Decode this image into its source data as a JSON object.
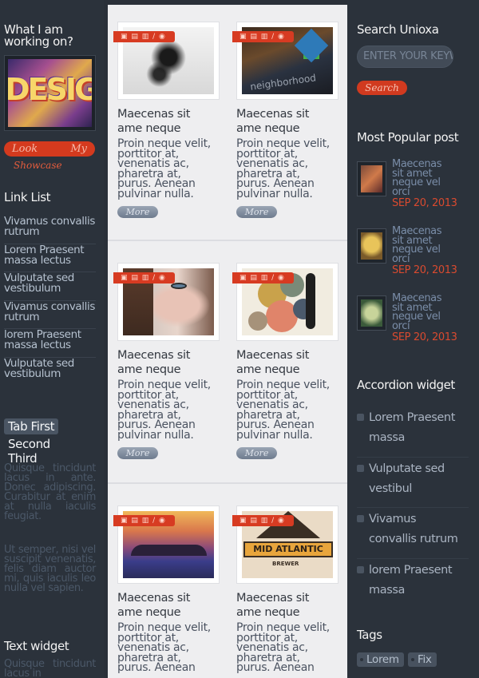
{
  "left": {
    "working_title": "What I am working on?",
    "showcase_image_text": "DESIGN",
    "showcase_btn_left": "Look",
    "showcase_btn_right": "My",
    "showcase_btn_line2": "Showcase",
    "linklist_title": "Link List",
    "links": [
      "Vivamus convallis rutrum",
      "Lorem Praesent massa lectus",
      "Vulputate sed vestibulum",
      "Vivamus convallis rutrum",
      "lorem Praesent massa lectus",
      "Vulputate sed vestibulum"
    ],
    "tabs": {
      "first": "Tab First",
      "second": "Second",
      "third": "Third"
    },
    "tab_para1": "Quisque tincidunt lacus in ante. Donec adipiscing. Curabitur at enim at nulla iaculis feugiat.",
    "tab_para2": "Ut semper, nisi vel suscipit venenatis, felis diam auctor mi, quis iaculis leo nulla vel sapien.",
    "textwidget_title": "Text widget",
    "textwidget_para": "Quisque tincidunt lacus in"
  },
  "posts": [
    {
      "title": "Maecenas sit ame neque",
      "body": "Proin neque velit, porttitor at, venenatis ac, pharetra at, purus. Aenean pulvinar nulla.",
      "more": "More",
      "tagbar": "▣ ▤ ▥ / ◉"
    },
    {
      "title": "Maecenas sit ame neque",
      "body": "Proin neque velit, porttitor at, venenatis ac, pharetra at, purus. Aenean pulvinar nulla.",
      "more": "More",
      "tagbar": "▣ ▤ ▥ / ◉",
      "thumb_text": "neighborhood"
    },
    {
      "title": "Maecenas sit ame neque",
      "body": "Proin neque velit, porttitor at, venenatis ac, pharetra at, purus. Aenean pulvinar nulla.",
      "more": "More",
      "tagbar": "▣ ▤ ▥ / ◉"
    },
    {
      "title": "Maecenas sit ame neque",
      "body": "Proin neque velit, porttitor at, venenatis ac, pharetra at, purus. Aenean pulvinar nulla.",
      "more": "More",
      "tagbar": "▣ ▤ ▥ / ◉"
    },
    {
      "title": "Maecenas sit ame neque",
      "body": "Proin neque velit, porttitor at, venenatis ac, pharetra at, purus. Aenean",
      "more": "More",
      "tagbar": "▣ ▤ ▥ / ◉"
    },
    {
      "title": "Maecenas sit ame neque",
      "body": "Proin neque velit, porttitor at, venenatis ac, pharetra at, purus. Aenean",
      "more": "More",
      "tagbar": "▣ ▤ ▥ / ◉",
      "thumb_text": "MID ATLANTIC",
      "thumb_sub": "BREWER"
    }
  ],
  "right": {
    "search_title": "Search Unioxa",
    "search_placeholder": "ENTER YOUR KEYWORD",
    "search_button": "Search",
    "popular_title": "Most Popular post",
    "popular": [
      {
        "title": "Maecenas sit amet neque vel orci",
        "date": "SEP 20, 2013"
      },
      {
        "title": "Maecenas sit amet neque vel orci",
        "date": "SEP 20, 2013"
      },
      {
        "title": "Maecenas sit amet neque vel orci",
        "date": "SEP 20, 2013"
      }
    ],
    "accordion_title": "Accordion widget",
    "accordion": [
      "Lorem Praesent massa",
      "Vulputate sed vestibul",
      "Vivamus convallis rutrum",
      "lorem Praesent massa"
    ],
    "tags_title": "Tags",
    "tags": [
      "Lorem",
      "Fix"
    ]
  }
}
